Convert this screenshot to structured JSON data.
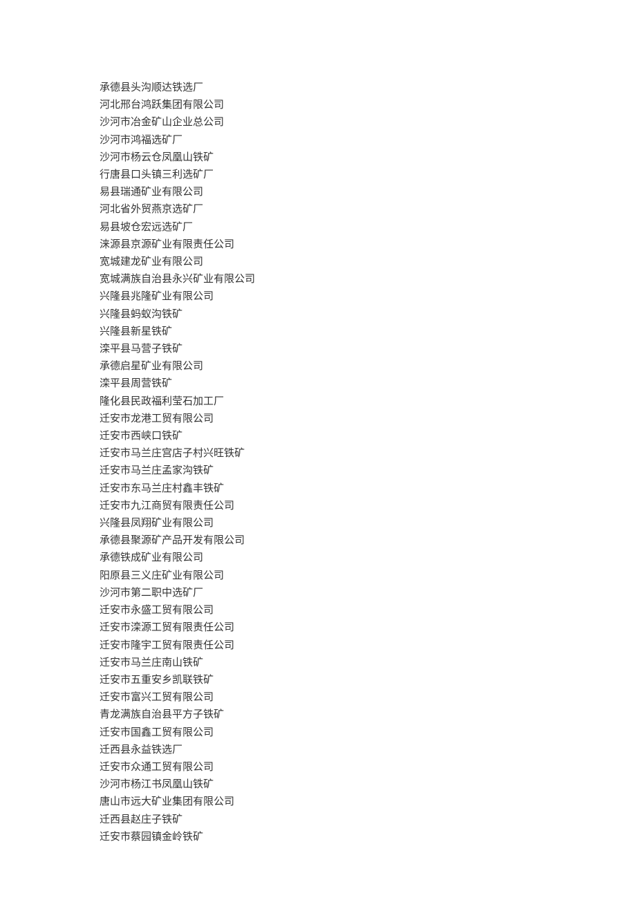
{
  "companies": [
    "承德县头沟顺达铁选厂",
    "河北邢台鸿跃集团有限公司",
    "沙河市冶金矿山企业总公司",
    "沙河市鸿福选矿厂",
    "沙河市杨云仓凤凰山铁矿",
    "行唐县口头镇三利选矿厂",
    "易县瑞通矿业有限公司",
    "河北省外贸燕京选矿厂",
    "易县坡仓宏远选矿厂",
    "涞源县京源矿业有限责任公司",
    "宽城建龙矿业有限公司",
    "宽城满族自治县永兴矿业有限公司",
    "兴隆县兆隆矿业有限公司",
    "兴隆县蚂蚁沟铁矿",
    "兴隆县新星铁矿",
    "滦平县马营子铁矿",
    "承德启星矿业有限公司",
    "滦平县周营铁矿",
    "隆化县民政福利莹石加工厂",
    "迁安市龙港工贸有限公司",
    "迁安市西峡口铁矿",
    "迁安市马兰庄宫店子村兴旺铁矿",
    "迁安市马兰庄孟家沟铁矿",
    "迁安市东马兰庄村鑫丰铁矿",
    "迁安市九江商贸有限责任公司",
    "兴隆县凤翔矿业有限公司",
    "承德县聚源矿产品开发有限公司",
    "承德铁成矿业有限公司",
    "阳原县三义庄矿业有限公司",
    "沙河市第二职中选矿厂",
    "迁安市永盛工贸有限公司",
    "迁安市滦源工贸有限责任公司",
    "迁安市隆宇工贸有限责任公司",
    "迁安市马兰庄南山铁矿",
    "迁安市五重安乡凯联铁矿",
    "迁安市富兴工贸有限公司",
    "青龙满族自治县平方子铁矿",
    "迁安市国鑫工贸有限公司",
    "迁西县永益铁选厂",
    "迁安市众通工贸有限公司",
    "沙河市杨江书凤凰山铁矿",
    "唐山市远大矿业集团有限公司",
    "迁西县赵庄子铁矿",
    "迁安市蔡园镇金岭铁矿"
  ]
}
